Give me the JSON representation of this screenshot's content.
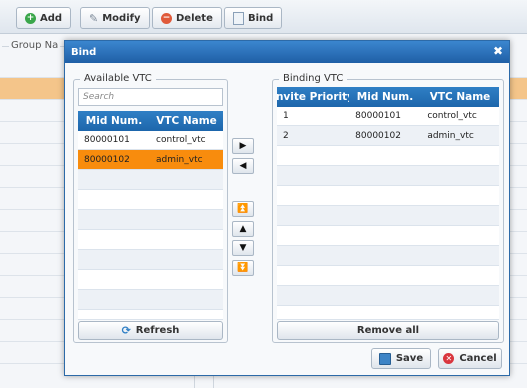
{
  "toolbar": {
    "add_label": "Add",
    "modify_label": "Modify",
    "delete_label": "Delete",
    "bind_label": "Bind",
    "colors": {
      "add": "#3aa64a",
      "delete": "#e05a3a"
    }
  },
  "background": {
    "group_legend": "Group Na"
  },
  "dialog": {
    "title": "Bind",
    "close_glyph": "✖",
    "available": {
      "legend": "Available VTC",
      "search_placeholder": "Search",
      "columns": [
        "Mid Num.",
        "VTC Name"
      ],
      "rows": [
        {
          "mid": "80000101",
          "name": "control_vtc",
          "selected": false
        },
        {
          "mid": "80000102",
          "name": "admin_vtc",
          "selected": true
        }
      ],
      "refresh_label": "Refresh"
    },
    "move_buttons": {
      "add_one": "▶",
      "remove_one": "◀",
      "move_top": "⏫",
      "move_up": "▲",
      "move_down": "▼",
      "move_bottom": "⏬"
    },
    "binding": {
      "legend": "Binding VTC",
      "columns": [
        "Invite Priority",
        "Mid Num.",
        "VTC Name"
      ],
      "rows": [
        {
          "priority": "1",
          "mid": "80000101",
          "name": "control_vtc"
        },
        {
          "priority": "2",
          "mid": "80000102",
          "name": "admin_vtc"
        }
      ],
      "remove_all_label": "Remove all"
    },
    "save_label": "Save",
    "cancel_label": "Cancel",
    "selection_color": "#f88c0d",
    "header_color": "#1f6aae"
  }
}
